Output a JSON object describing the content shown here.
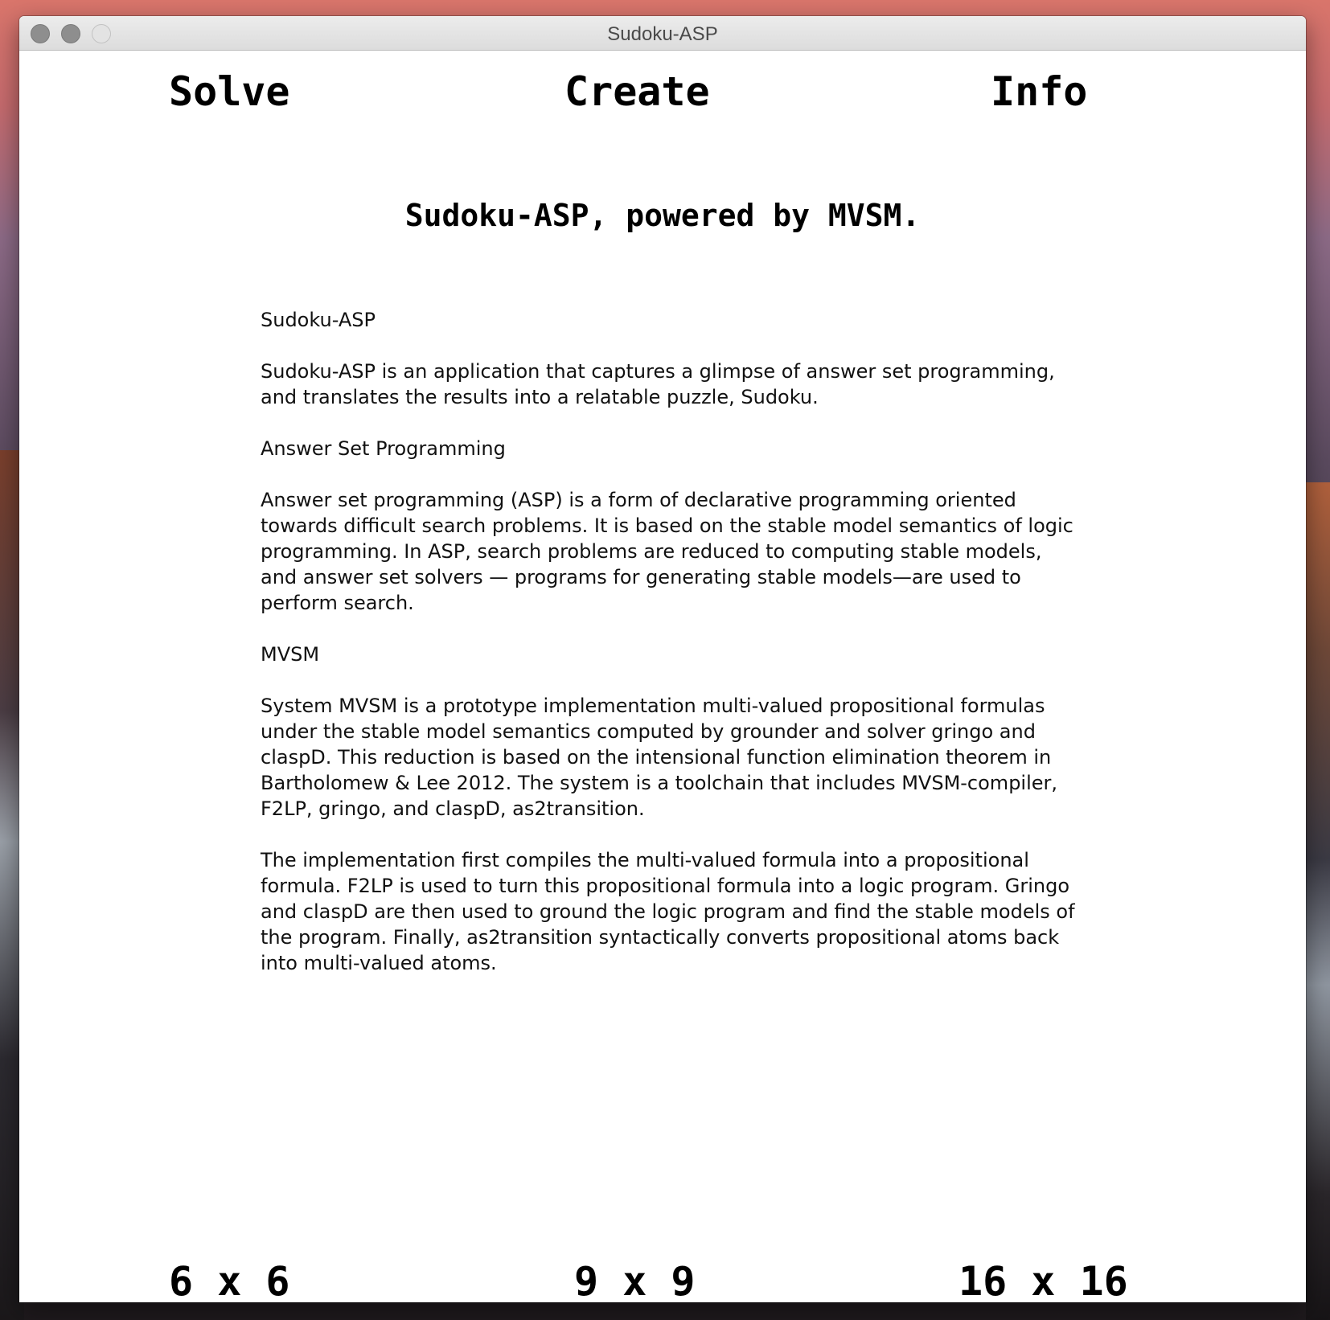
{
  "window": {
    "title": "Sudoku-ASP"
  },
  "top_nav": {
    "solve": "Solve",
    "create": "Create",
    "info": "Info"
  },
  "main": {
    "heading": "Sudoku-ASP, powered by MVSM.",
    "paragraphs": [
      "Sudoku-ASP",
      "Sudoku-ASP is an application that captures a glimpse of answer set programming, and translates the results into a relatable puzzle, Sudoku.",
      "Answer Set Programming",
      "Answer set programming (ASP) is a form of declarative programming oriented towards difficult search problems. It is based on the stable model semantics of logic programming. In ASP, search problems are reduced to computing stable models, and answer set solvers — programs for generating stable models—are used to perform search.",
      "MVSM",
      "System MVSM is a prototype implementation multi-valued propositional formulas under the stable model semantics computed by grounder and solver gringo and claspD. This reduction is based on the intensional function elimination theorem in Bartholomew & Lee 2012. The system is a toolchain that includes MVSM-compiler, F2LP, gringo, and claspD, as2transition.",
      "The implementation first compiles the multi-valued formula into a propositional formula. F2LP is used to turn this propositional formula into a logic program. Gringo and claspD are then used to ground the logic program and find the stable models of the program. Finally, as2transition syntactically converts propositional atoms back into multi-valued atoms."
    ]
  },
  "bottom_nav": {
    "size_6": "6 x 6",
    "size_9": "9 x 9",
    "size_16": "16 x 16"
  }
}
